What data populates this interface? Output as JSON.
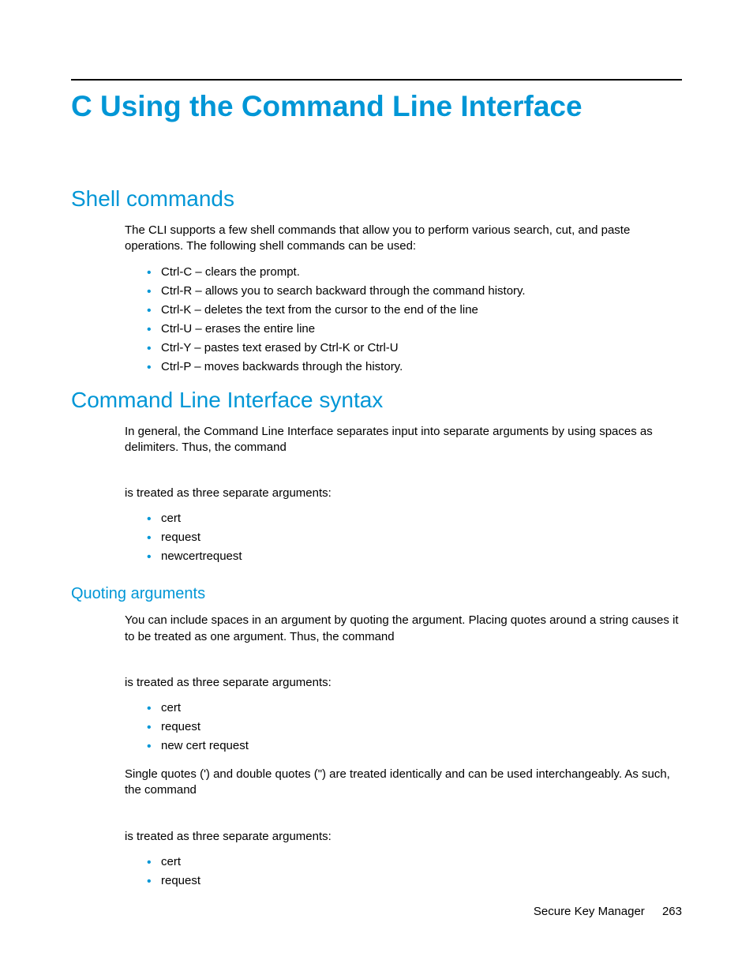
{
  "chapter": {
    "title": "C Using the Command Line Interface"
  },
  "sections": {
    "shell_commands": {
      "heading": "Shell commands",
      "intro": "The CLI supports a few shell commands that allow you to perform various search, cut, and paste operations. The following shell commands can be used:",
      "bullets": [
        "Ctrl-C – clears the prompt.",
        "Ctrl-R – allows you to search backward through the command history.",
        "Ctrl-K – deletes the text from the cursor to the end of the line",
        "Ctrl-U – erases the entire line",
        "Ctrl-Y – pastes text erased by Ctrl-K or Ctrl-U",
        "Ctrl-P – moves backwards through the history."
      ]
    },
    "cli_syntax": {
      "heading": "Command Line Interface syntax",
      "intro": "In general, the Command Line Interface separates input into separate arguments by using spaces as delimiters. Thus, the command",
      "treated_as": "is treated as three separate arguments:",
      "bullets": [
        "cert",
        "request",
        "newcertrequest"
      ]
    },
    "quoting": {
      "heading": "Quoting arguments",
      "intro": "You can include spaces in an argument by quoting the argument. Placing quotes around a string causes it to be treated as one argument. Thus, the command",
      "treated_as_1": "is treated as three separate arguments:",
      "bullets_1": [
        "cert",
        "request",
        "new cert request"
      ],
      "single_double": "Single quotes (') and double quotes (\") are treated identically and can be used interchangeably. As such, the command",
      "treated_as_2": "is treated as three separate arguments:",
      "bullets_2": [
        "cert",
        "request"
      ]
    }
  },
  "footer": {
    "doc_title": "Secure Key Manager",
    "page_number": "263"
  }
}
